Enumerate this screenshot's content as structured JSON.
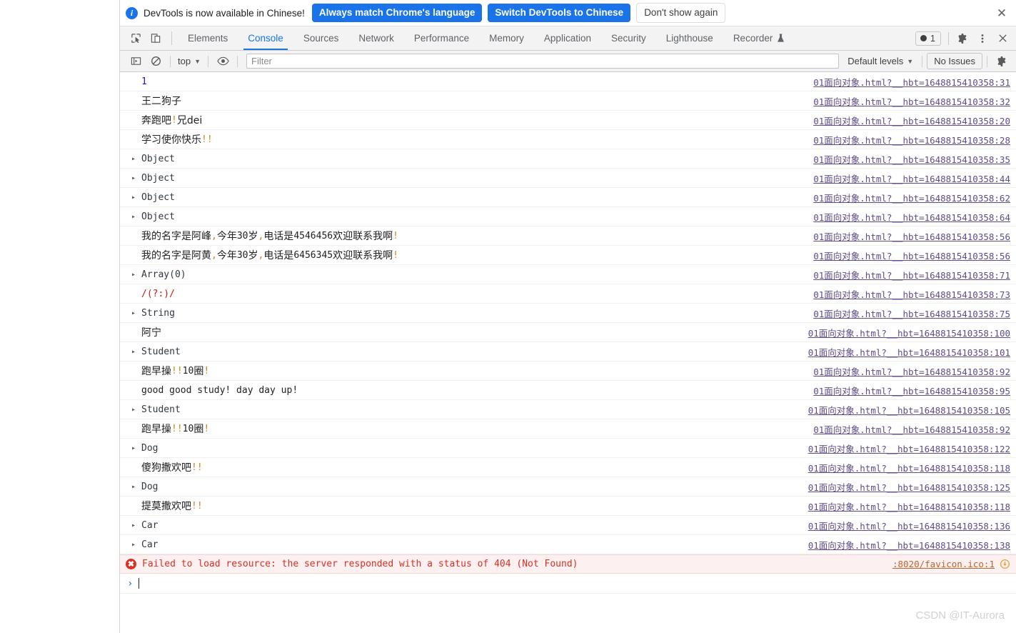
{
  "notice": {
    "icon": "info-icon",
    "text": "DevTools is now available in Chinese!",
    "primary_button": "Always match Chrome's language",
    "secondary_button": "Switch DevTools to Chinese",
    "dismiss_button": "Don't show again",
    "close_icon": "✕",
    "accent_color": "#1a73e8"
  },
  "tabbar": {
    "inspect_icon": "inspect-element-icon",
    "device_icon": "device-toolbar-icon",
    "tabs": [
      {
        "label": "Elements",
        "active": false
      },
      {
        "label": "Console",
        "active": true
      },
      {
        "label": "Sources",
        "active": false
      },
      {
        "label": "Network",
        "active": false
      },
      {
        "label": "Performance",
        "active": false
      },
      {
        "label": "Memory",
        "active": false
      },
      {
        "label": "Application",
        "active": false
      },
      {
        "label": "Security",
        "active": false
      },
      {
        "label": "Lighthouse",
        "active": false
      },
      {
        "label": "Recorder",
        "active": false,
        "badge_icon": "flask-icon"
      }
    ],
    "error_count": "1",
    "settings_icon": "gear-icon",
    "more_icon": "kebab-menu-icon",
    "close_icon": "close-icon",
    "active_color": "#1a73e8"
  },
  "filterbar": {
    "sidebar_icon": "console-sidebar-icon",
    "clear_icon": "clear-console-icon",
    "context": "top",
    "context_caret": "▼",
    "eye_icon": "live-expression-icon",
    "filter_placeholder": "Filter",
    "filter_value": "",
    "levels": "Default levels",
    "levels_caret": "▼",
    "issues": "No Issues",
    "settings_icon": "console-settings-icon"
  },
  "console": {
    "rows": [
      {
        "kind": "number",
        "text": "1",
        "source": "01面向对象.html?__hbt=1648815410358:31"
      },
      {
        "kind": "text",
        "text": "王二狗子",
        "source": "01面向对象.html?__hbt=1648815410358:32"
      },
      {
        "kind": "text",
        "text": "奔跑吧!兄dei",
        "source": "01面向对象.html?__hbt=1648815410358:20"
      },
      {
        "kind": "text",
        "text": "学习使你快乐!!",
        "source": "01面向对象.html?__hbt=1648815410358:28"
      },
      {
        "kind": "object",
        "text": "Object",
        "source": "01面向对象.html?__hbt=1648815410358:35"
      },
      {
        "kind": "object",
        "text": "Object",
        "source": "01面向对象.html?__hbt=1648815410358:44"
      },
      {
        "kind": "object",
        "text": "Object",
        "source": "01面向对象.html?__hbt=1648815410358:62"
      },
      {
        "kind": "object",
        "text": "Object",
        "source": "01面向对象.html?__hbt=1648815410358:64"
      },
      {
        "kind": "text",
        "text": "我的名字是阿峰,今年30岁,电话是4546456欢迎联系我啊!",
        "source": "01面向对象.html?__hbt=1648815410358:56"
      },
      {
        "kind": "text",
        "text": "我的名字是阿黄,今年30岁,电话是6456345欢迎联系我啊!",
        "source": "01面向对象.html?__hbt=1648815410358:56"
      },
      {
        "kind": "object",
        "text": "Array(0)",
        "source": "01面向对象.html?__hbt=1648815410358:71"
      },
      {
        "kind": "regex",
        "text": "/(?:)/",
        "source": "01面向对象.html?__hbt=1648815410358:73"
      },
      {
        "kind": "object",
        "text": "String",
        "source": "01面向对象.html?__hbt=1648815410358:75"
      },
      {
        "kind": "text",
        "text": "阿宁",
        "source": "01面向对象.html?__hbt=1648815410358:100"
      },
      {
        "kind": "object",
        "text": "Student",
        "source": "01面向对象.html?__hbt=1648815410358:101"
      },
      {
        "kind": "text",
        "text": "跑早操!!10圈!",
        "source": "01面向对象.html?__hbt=1648815410358:92"
      },
      {
        "kind": "mono",
        "text": "good good study! day day up!",
        "source": "01面向对象.html?__hbt=1648815410358:95"
      },
      {
        "kind": "object",
        "text": "Student",
        "source": "01面向对象.html?__hbt=1648815410358:105"
      },
      {
        "kind": "text",
        "text": "跑早操!!10圈!",
        "source": "01面向对象.html?__hbt=1648815410358:92"
      },
      {
        "kind": "object",
        "text": "Dog",
        "source": "01面向对象.html?__hbt=1648815410358:122"
      },
      {
        "kind": "text",
        "text": "傻狗撒欢吧!!",
        "source": "01面向对象.html?__hbt=1648815410358:118"
      },
      {
        "kind": "object",
        "text": "Dog",
        "source": "01面向对象.html?__hbt=1648815410358:125"
      },
      {
        "kind": "text",
        "text": "提莫撒欢吧!!",
        "source": "01面向对象.html?__hbt=1648815410358:118"
      },
      {
        "kind": "object",
        "text": "Car",
        "source": "01面向对象.html?__hbt=1648815410358:136"
      },
      {
        "kind": "object",
        "text": "Car",
        "source": "01面向对象.html?__hbt=1648815410358:138"
      }
    ],
    "error": {
      "icon": "error-icon",
      "text": "Failed to load resource: the server responded with a status of 404 (Not Found)",
      "source": ":8020/favicon.ico:1",
      "reload_icon": "reload-circle-icon",
      "color": "#d93025"
    },
    "prompt": {
      "caret": "›",
      "value": ""
    },
    "expand_arrow": "▸"
  },
  "watermark": "CSDN @IT-Aurora"
}
